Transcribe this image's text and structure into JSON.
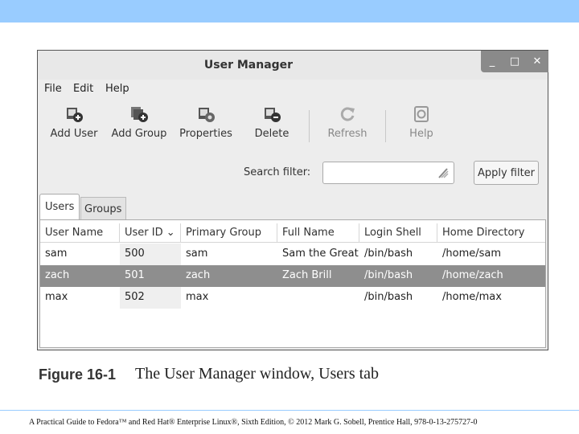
{
  "window": {
    "title": "User Manager",
    "controls": {
      "minimize": "_",
      "maximize": "□",
      "close": "✕"
    }
  },
  "menubar": {
    "items": [
      "File",
      "Edit",
      "Help"
    ]
  },
  "toolbar": {
    "items": [
      {
        "label": "Add User",
        "icon": "add-user-icon"
      },
      {
        "label": "Add Group",
        "icon": "add-group-icon"
      },
      {
        "label": "Properties",
        "icon": "properties-icon"
      },
      {
        "label": "Delete",
        "icon": "delete-icon"
      },
      {
        "label": "Refresh",
        "icon": "refresh-icon"
      },
      {
        "label": "Help",
        "icon": "help-icon"
      }
    ]
  },
  "search": {
    "label": "Search filter:",
    "value": "",
    "apply_label": "Apply filter"
  },
  "tabs": [
    "Users",
    "Groups"
  ],
  "table": {
    "columns": [
      "User Name",
      "User ID",
      "Primary Group",
      "Full Name",
      "Login Shell",
      "Home Directory"
    ],
    "sort_indicator": "⌄",
    "rows": [
      {
        "user_name": "sam",
        "user_id": "500",
        "primary_group": "sam",
        "full_name": "Sam the Great",
        "login_shell": "/bin/bash",
        "home_directory": "/home/sam"
      },
      {
        "user_name": "zach",
        "user_id": "501",
        "primary_group": "zach",
        "full_name": "Zach Brill",
        "login_shell": "/bin/bash",
        "home_directory": "/home/zach"
      },
      {
        "user_name": "max",
        "user_id": "502",
        "primary_group": "max",
        "full_name": "",
        "login_shell": "/bin/bash",
        "home_directory": "/home/max"
      }
    ],
    "selected_row": "zach"
  },
  "caption": {
    "number": "Figure 16-1",
    "text": "The User Manager window, Users tab"
  },
  "footer": "A Practical Guide to Fedora™ and Red Hat® Enterprise Linux®, Sixth Edition, © 2012 Mark G. Sobell, Prentice Hall, 978-0-13-275727-0",
  "colors": {
    "header_band": "#99ccff",
    "selected_row": "#8e8e8e",
    "window_bg": "#ededed"
  }
}
